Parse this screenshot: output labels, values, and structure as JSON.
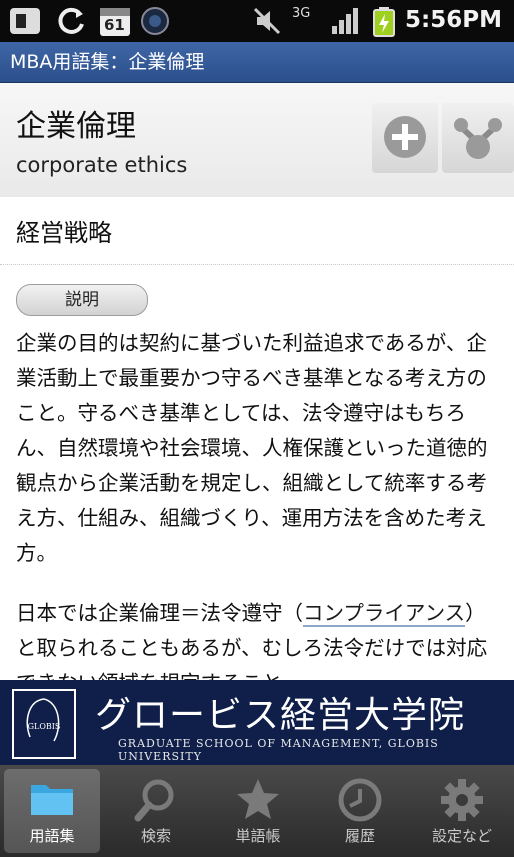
{
  "status_bar": {
    "time": "5:56PM",
    "calendar_day": "61",
    "network": "3G",
    "icons": [
      "usb-icon",
      "sync-icon",
      "calendar-icon",
      "camera-icon",
      "mute-icon",
      "network-3g-icon",
      "signal-icon",
      "battery-charging-icon"
    ]
  },
  "app_bar": {
    "title": "MBA用語集：企業倫理"
  },
  "term": {
    "title": "企業倫理",
    "english": "corporate ethics",
    "add_icon": "plus-icon",
    "related_icon": "network-icon"
  },
  "category": {
    "label": "経営戦略"
  },
  "description": {
    "pill_label": "説明",
    "paragraph1": "企業の目的は契約に基づいた利益追求であるが、企業活動上で最重要かつ守るべき基準となる考え方のこと。守るべき基準としては、法令遵守はもちろん、自然環境や社会環境、人権保護といった道徳的観点から企業活動を規定し、組織として統率する考え方、仕組み、組織づくり、運用方法を含めた考え方。",
    "p2_before": "日本では企業倫理＝法令遵守（",
    "p2_link": "コンプライアンス",
    "p2_after": "）と取られることもあるが、むしろ法令だけでは対応できない領域を規定すること"
  },
  "banner": {
    "logo_text": "GLOBIS",
    "title": "グロービス経営大学院",
    "subtitle": "GRADUATE SCHOOL OF MANAGEMENT, GLOBIS UNIVERSITY"
  },
  "tabs": [
    {
      "label": "用語集",
      "icon": "folder-icon",
      "active": true
    },
    {
      "label": "検索",
      "icon": "search-icon",
      "active": false
    },
    {
      "label": "単語帳",
      "icon": "star-icon",
      "active": false
    },
    {
      "label": "履歴",
      "icon": "clock-icon",
      "active": false
    },
    {
      "label": "設定など",
      "icon": "gear-icon",
      "active": false
    }
  ],
  "colors": {
    "title_bar": "#3f66a6",
    "banner": "#0f1f4a",
    "tab_bar": "#333333"
  }
}
